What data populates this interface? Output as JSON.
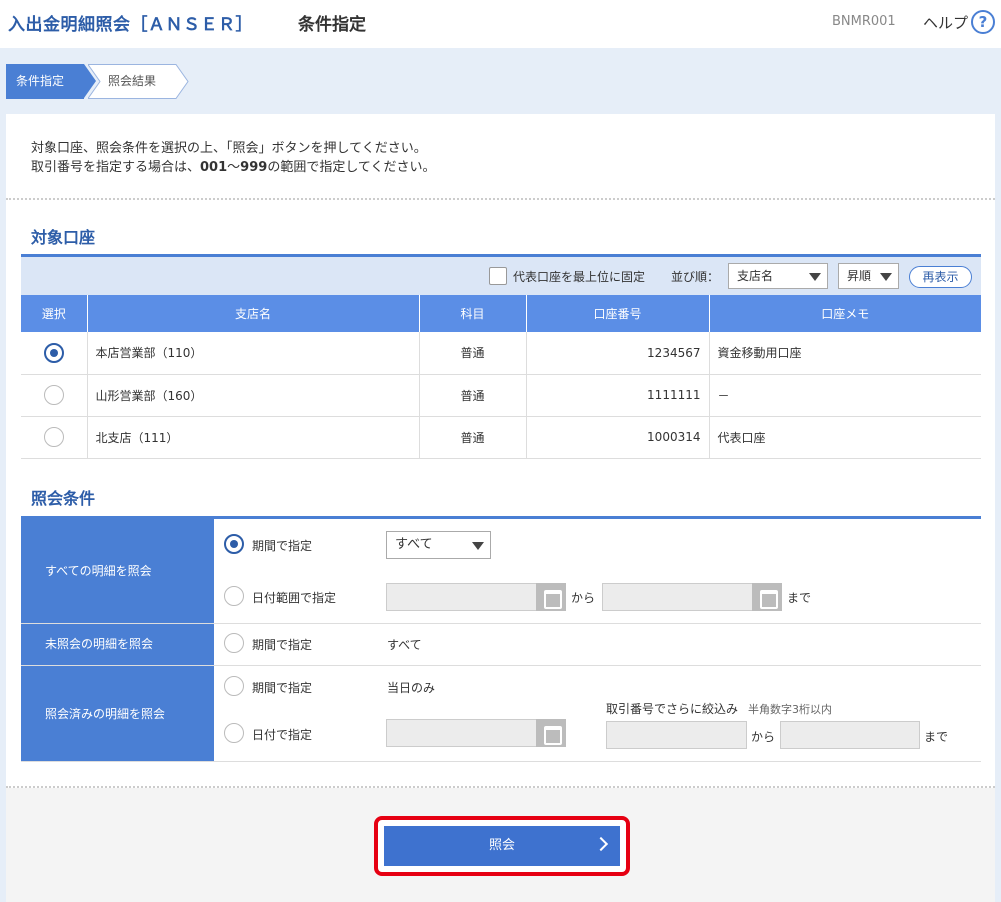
{
  "header": {
    "app_title": "入出金明細照会［ＡＮＳＥＲ］",
    "page_title": "条件指定",
    "screen_id": "BNMR001",
    "help_label": "ヘルプ",
    "help_icon_glyph": "?"
  },
  "steps": {
    "current": "条件指定",
    "next": "照会結果"
  },
  "instructions": {
    "line1": "対象口座、照会条件を選択の上、「照会」ボタンを押してください。",
    "line2_pre": "取引番号を指定する場合は、",
    "line2_from": "001",
    "line2_tilde": "～",
    "line2_to": "999",
    "line2_post": "の範囲で指定してください。"
  },
  "accounts_section": {
    "title": "対象口座",
    "rep_fix_label": "代表口座を最上位に固定",
    "rep_fix_checked": false,
    "sort_label": "並び順：",
    "sort_field": "支店名",
    "sort_order": "昇順",
    "redisplay_label": "再表示",
    "columns": [
      "選択",
      "支店名",
      "科目",
      "口座番号",
      "口座メモ"
    ],
    "rows": [
      {
        "selected": true,
        "branch": "本店営業部（110）",
        "type": "普通",
        "number": "1234567",
        "memo": "資金移動用口座"
      },
      {
        "selected": false,
        "branch": "山形営業部（160）",
        "type": "普通",
        "number": "1111111",
        "memo": "－"
      },
      {
        "selected": false,
        "branch": "北支店（111）",
        "type": "普通",
        "number": "1000314",
        "memo": "代表口座"
      }
    ]
  },
  "conditions_section": {
    "title": "照会条件",
    "all": {
      "label": "すべての明細を照会",
      "period_label": "期間で指定",
      "period_value": "すべて",
      "range_label": "日付範囲で指定",
      "from_text": "から",
      "to_text": "まで"
    },
    "unviewed": {
      "label": "未照会の明細を照会",
      "period_label": "期間で指定",
      "period_value": "すべて"
    },
    "viewed": {
      "label": "照会済みの明細を照会",
      "period_label": "期間で指定",
      "period_value": "当日のみ",
      "date_label": "日付で指定",
      "txn_filter_label": "取引番号でさらに絞込み",
      "txn_filter_hint": "半角数字3桁以内",
      "from_text": "から",
      "to_text": "まで"
    }
  },
  "submit": {
    "label": "照会"
  },
  "colors": {
    "accent": "#4a7fd4",
    "header_blue": "#5b8ee6",
    "highlight_red": "#e60012"
  }
}
